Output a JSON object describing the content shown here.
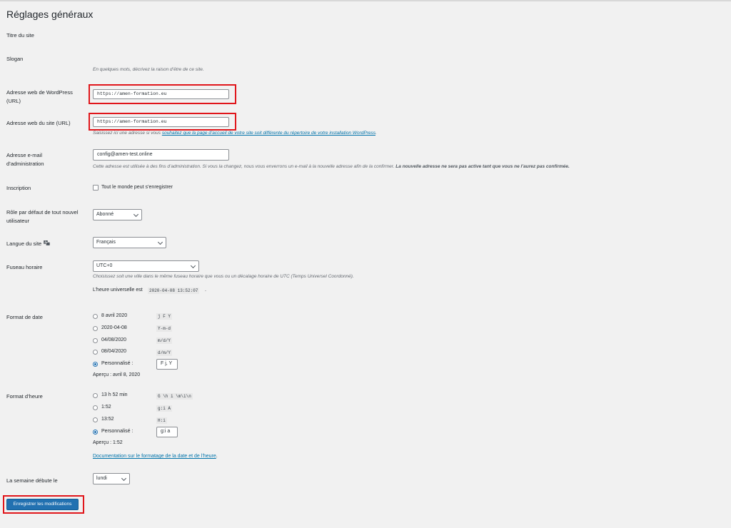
{
  "page": {
    "title": "Réglages généraux"
  },
  "fields": {
    "site_title": {
      "label": "Titre du site"
    },
    "tagline": {
      "label": "Slogan",
      "description": "En quelques mots, décrivez la raison d’être de ce site."
    },
    "wp_url": {
      "label": "Adresse web de WordPress (URL)",
      "value": "https://amen-formation.eu"
    },
    "site_url": {
      "label": "Adresse web du site (URL)",
      "value": "https://amen-formation.eu",
      "desc_before": "Saisissez ici une adresse si vous ",
      "desc_link": "souhaitez que la page d’accueil de votre site soit différente du répertoire de votre installation WordPress",
      "desc_after": "."
    },
    "admin_email": {
      "label": "Adresse e-mail d’administration",
      "value": "config@amen-test.online",
      "desc": "Cette adresse est utilisée à des fins d’administration. Si vous la changez, nous vous enverrons un e-mail à la nouvelle adresse afin de la confirmer. ",
      "desc_bold": "La nouvelle adresse ne sera pas active tant que vous ne l’aurez pas confirmée."
    },
    "membership": {
      "label": "Inscription",
      "checkbox_label": "Tout le monde peut s’enregistrer"
    },
    "default_role": {
      "label": "Rôle par défaut de tout nouvel utilisateur",
      "value": "Abonné"
    },
    "site_language": {
      "label": "Langue du site",
      "value": "Français",
      "icon": "translate-icon"
    },
    "timezone": {
      "label": "Fuseau horaire",
      "value": "UTC+0",
      "desc": "Choisissez soit une ville dans le même fuseau horaire que vous ou un décalage horaire de UTC (Temps Universel Coordonné).",
      "utc_prefix": "L’heure universelle est",
      "utc_time": "2020-04-08 13:52:07",
      "utc_suffix": "."
    },
    "date_format": {
      "label": "Format de date",
      "options": [
        {
          "label": "8 avril 2020",
          "code": "j F Y",
          "checked": false
        },
        {
          "label": "2020-04-08",
          "code": "Y-m-d",
          "checked": false
        },
        {
          "label": "04/08/2020",
          "code": "m/d/Y",
          "checked": false
        },
        {
          "label": "08/04/2020",
          "code": "d/m/Y",
          "checked": false
        }
      ],
      "custom_label": "Personnalisé :",
      "custom_value": "F j, Y",
      "custom_checked": true,
      "preview": "Aperçu : avril 8, 2020"
    },
    "time_format": {
      "label": "Format d’heure",
      "options": [
        {
          "label": "13 h 52 min",
          "code": "G \\h i \\m\\i\\n",
          "checked": false
        },
        {
          "label": "1:52",
          "code": "g:i A",
          "checked": false
        },
        {
          "label": "13:52",
          "code": "H:i",
          "checked": false
        }
      ],
      "custom_label": "Personnalisé :",
      "custom_value": "g:i a",
      "custom_checked": true,
      "preview": "Aperçu : 1:52",
      "doc_link": "Documentation sur le formatage de la date et de l’heure",
      "doc_suffix": "."
    },
    "start_of_week": {
      "label": "La semaine débute le",
      "value": "lundi"
    }
  },
  "submit": {
    "label": "Enregistrer les modifications"
  },
  "colors": {
    "highlight": "#e0161b",
    "primary": "#2271b1",
    "link": "#0073aa"
  }
}
